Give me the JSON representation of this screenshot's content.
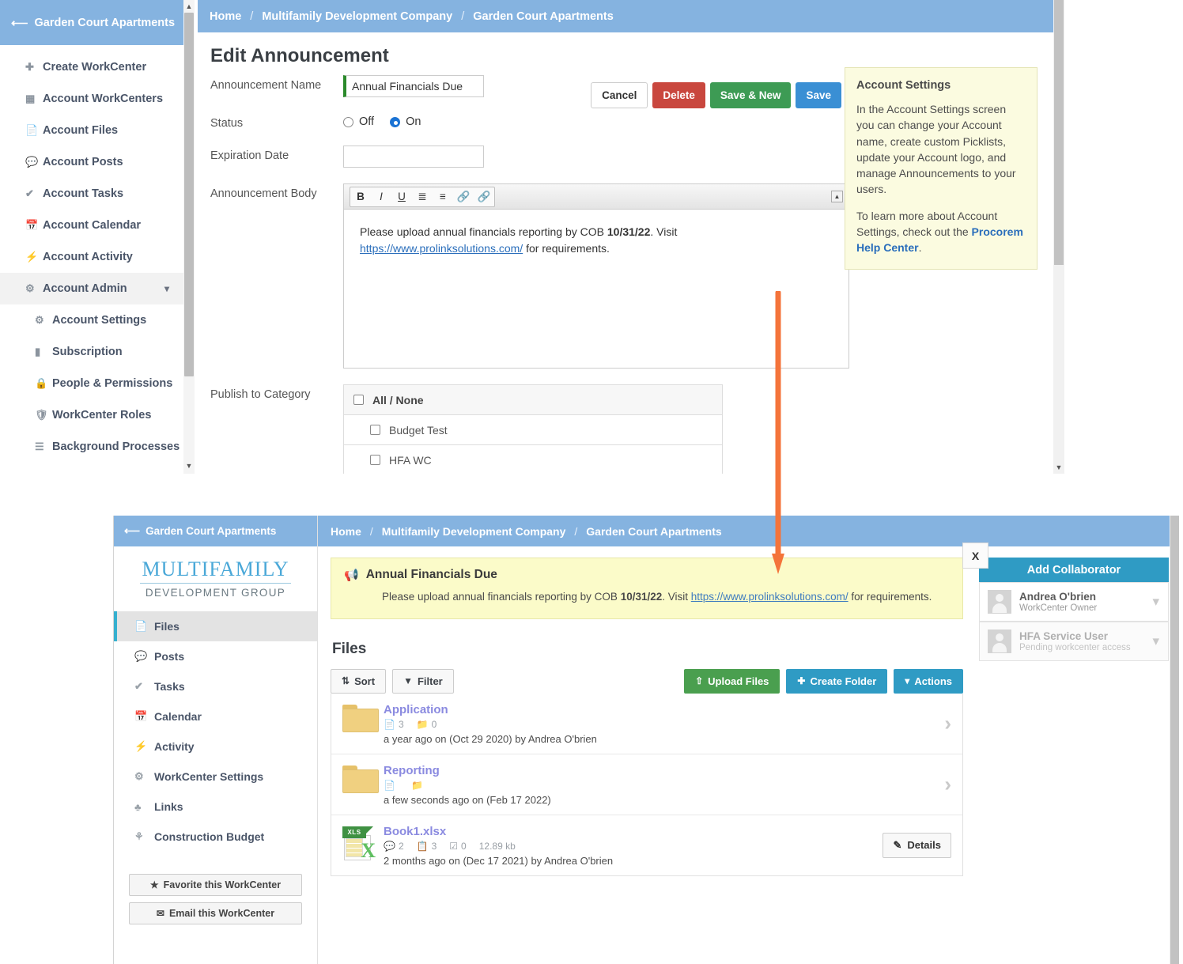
{
  "accent": {
    "header_blue": "#85b3e0",
    "teal": "#2f9bc4",
    "green": "#4a9f4f",
    "red": "#c9473e",
    "save_blue": "#3a8fd4",
    "annotation_orange": "#f4743b",
    "announce_yellow": "#fbfbc9"
  },
  "window1": {
    "sidebar": {
      "title": "Garden Court Apartments",
      "back_icon": "arrow-left-icon",
      "items": [
        {
          "label": "Create WorkCenter",
          "icon": "plus-icon",
          "sub": false
        },
        {
          "label": "Account WorkCenters",
          "icon": "grid-icon",
          "sub": false
        },
        {
          "label": "Account Files",
          "icon": "file-icon",
          "sub": false
        },
        {
          "label": "Account Posts",
          "icon": "comments-icon",
          "sub": false
        },
        {
          "label": "Account Tasks",
          "icon": "check-icon",
          "sub": false
        },
        {
          "label": "Account Calendar",
          "icon": "calendar-icon",
          "sub": false
        },
        {
          "label": "Account Activity",
          "icon": "bolt-icon",
          "sub": false
        },
        {
          "label": "Account Admin",
          "icon": "cogs-icon",
          "sub": false,
          "expanded": true,
          "chevron": "chevron-down-icon"
        },
        {
          "label": "Account Settings",
          "icon": "gear-icon",
          "sub": true
        },
        {
          "label": "Subscription",
          "icon": "money-icon",
          "sub": true
        },
        {
          "label": "People & Permissions",
          "icon": "lock-icon",
          "sub": true
        },
        {
          "label": "WorkCenter Roles",
          "icon": "shield-icon",
          "sub": true
        },
        {
          "label": "Background Processes",
          "icon": "list-icon",
          "sub": true
        }
      ]
    },
    "breadcrumb": {
      "home": "Home",
      "company": "Multifamily Development Company",
      "workcenter": "Garden Court Apartments",
      "separator": "/"
    },
    "page_title": "Edit Announcement",
    "buttons": {
      "cancel": "Cancel",
      "delete": "Delete",
      "save_new": "Save & New",
      "save": "Save"
    },
    "form": {
      "name_label": "Announcement Name",
      "name_value": "Annual Financials Due",
      "status_label": "Status",
      "status_off": "Off",
      "status_on": "On",
      "status_selected": "On",
      "expiration_label": "Expiration Date",
      "expiration_value": "",
      "body_label": "Announcement Body",
      "body_text_1": "Please upload annual financials reporting by COB ",
      "body_bold": "10/31/22",
      "body_text_2": ". Visit ",
      "body_link": "https://www.prolinksolutions.com/",
      "body_text_3": " for requirements.",
      "toolbar_icons": [
        "bold-icon",
        "italic-icon",
        "underline-icon",
        "ordered-list-icon",
        "unordered-list-icon",
        "link-icon",
        "unlink-icon"
      ],
      "collapse_icon": "collapse-icon",
      "category_label": "Publish to Category",
      "category_header": "All / None",
      "categories": [
        "Budget Test",
        "HFA WC"
      ]
    },
    "aside": {
      "heading": "Account Settings",
      "p1": "In the Account Settings screen you can change your Account name, create custom Picklists, update your Account logo, and manage Announcements to your users.",
      "p2_pre": "To learn more about Account Settings, check out the ",
      "p2_link": "Procorem Help Center",
      "p2_post": "."
    }
  },
  "window2": {
    "sidebar": {
      "title": "Garden Court Apartments",
      "back_icon": "arrow-left-icon",
      "logo_top": "MULTIFAMILY",
      "logo_bottom": "DEVELOPMENT GROUP",
      "items": [
        {
          "label": "Files",
          "icon": "file-icon",
          "selected": true
        },
        {
          "label": "Posts",
          "icon": "comments-icon",
          "selected": false
        },
        {
          "label": "Tasks",
          "icon": "check-icon",
          "selected": false
        },
        {
          "label": "Calendar",
          "icon": "calendar-icon",
          "selected": false
        },
        {
          "label": "Activity",
          "icon": "bolt-icon",
          "selected": false
        },
        {
          "label": "WorkCenter Settings",
          "icon": "gear-icon",
          "selected": false
        },
        {
          "label": "Links",
          "icon": "sitemap-icon",
          "selected": false
        },
        {
          "label": "Construction Budget",
          "icon": "flask-icon",
          "selected": false
        }
      ],
      "favorite_button": "Favorite this WorkCenter",
      "favorite_icon": "star-icon",
      "email_button": "Email this WorkCenter",
      "email_icon": "envelope-icon"
    },
    "breadcrumb": {
      "home": "Home",
      "company": "Multifamily Development Company",
      "workcenter": "Garden Court Apartments",
      "separator": "/"
    },
    "announcement": {
      "icon": "megaphone-icon",
      "title": "Annual Financials Due",
      "text_1": "Please upload annual financials reporting by COB ",
      "bold": "10/31/22",
      "text_2": ". Visit ",
      "link": "https://www.prolinksolutions.com/",
      "text_3": " for requirements.",
      "close_label": "X"
    },
    "files": {
      "heading": "Files",
      "toolbar": {
        "sort": "Sort",
        "sort_icon": "sort-icon",
        "filter": "Filter",
        "filter_icon": "filter-icon",
        "upload": "Upload Files",
        "upload_icon": "upload-icon",
        "create_folder": "Create Folder",
        "create_folder_icon": "plus-icon",
        "actions": "Actions",
        "actions_icon": "chevron-down-icon"
      },
      "rows": [
        {
          "kind": "folder",
          "name": "Application",
          "file_count": "3",
          "folder_count": "0",
          "date": "a year ago on (Oct 29 2020) by Andrea O'brien",
          "action": "chevron"
        },
        {
          "kind": "folder",
          "name": "Reporting",
          "file_count": "",
          "folder_count": "",
          "date": "a few seconds ago on (Feb 17 2022)",
          "action": "chevron"
        },
        {
          "kind": "xls",
          "name": "Book1.xlsx",
          "comments": "2",
          "versions": "3",
          "tasks": "0",
          "size": "12.89 kb",
          "date": "2 months ago on (Dec 17 2021) by Andrea O'brien",
          "action": "details",
          "details_label": "Details",
          "details_icon": "edit-icon"
        }
      ]
    },
    "collaborators": {
      "add_button": "Add Collaborator",
      "people": [
        {
          "name": "Andrea O'brien",
          "role": "WorkCenter Owner",
          "pending": false
        },
        {
          "name": "HFA Service User",
          "role": "Pending workcenter access",
          "pending": true
        }
      ]
    }
  }
}
